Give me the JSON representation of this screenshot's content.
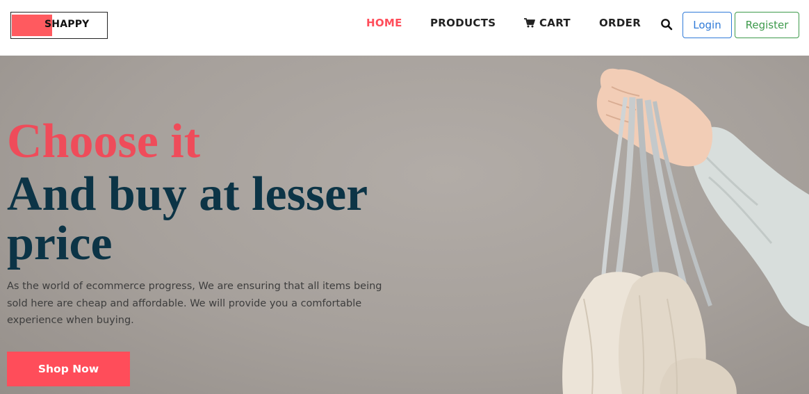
{
  "brand": {
    "logo_text": "SHAPPY",
    "accent": "#ff5a5f"
  },
  "nav": {
    "items": [
      {
        "label": "HOME",
        "active": true
      },
      {
        "label": "PRODUCTS"
      },
      {
        "label": "CART",
        "icon": "cart-icon"
      },
      {
        "label": "ORDER"
      }
    ],
    "search_icon": "search-icon"
  },
  "auth": {
    "login_label": "Login",
    "register_label": "Register"
  },
  "hero": {
    "headline_accent": "Choose it",
    "headline_main": "And buy at lesser price",
    "description": "As the world of ecommerce progress, We are ensuring that all items being sold here are cheap and affordable. We will provide you a comfortable experience when buying.",
    "cta_label": "Shop Now",
    "image": "hand-holding-shopping-bags"
  },
  "colors": {
    "accent": "#ff4d5a",
    "headline": "#0c3446",
    "login": "#2f7ad8",
    "register": "#3d9a4b"
  }
}
